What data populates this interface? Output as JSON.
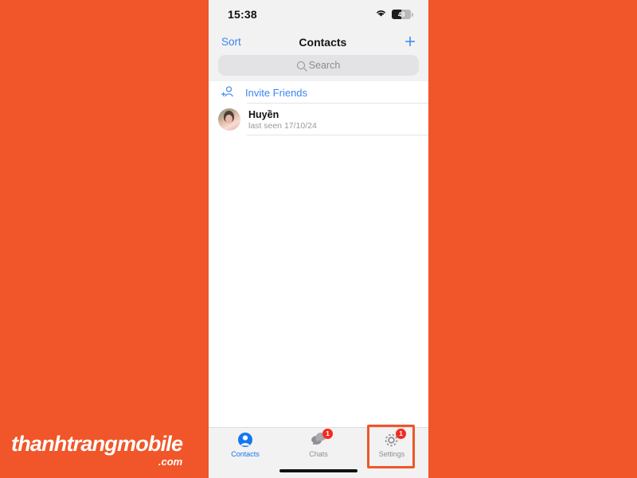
{
  "watermark": {
    "brand": "thanhtrangmobile",
    "tld": ".com"
  },
  "status_bar": {
    "time": "15:38",
    "wifi_icon": "wifi-icon",
    "battery_level": "49",
    "battery_icon": "battery-icon"
  },
  "nav_bar": {
    "sort_label": "Sort",
    "title": "Contacts",
    "add_icon": "plus-icon"
  },
  "search": {
    "placeholder": "Search",
    "icon": "search-icon"
  },
  "list": {
    "invite": {
      "label": "Invite Friends",
      "icon": "person-add-icon"
    },
    "contacts": [
      {
        "name": "Huyền",
        "status": "last seen 17/10/24",
        "avatar": "avatar"
      }
    ]
  },
  "tab_bar": {
    "tabs": [
      {
        "label": "Contacts",
        "icon": "person-circle-icon",
        "active": true,
        "badge": ""
      },
      {
        "label": "Chats",
        "icon": "chat-bubbles-icon",
        "active": false,
        "badge": "1"
      },
      {
        "label": "Settings",
        "icon": "gear-icon",
        "active": false,
        "badge": "1"
      }
    ]
  },
  "annotation": {
    "highlight_target": "Settings",
    "color": "#F05629"
  },
  "colors": {
    "background": "#F05629",
    "accent_blue": "#1478F0",
    "link_blue": "#3A86F5",
    "badge_red": "#F42B21",
    "chrome_gray": "#F2F2F2"
  }
}
